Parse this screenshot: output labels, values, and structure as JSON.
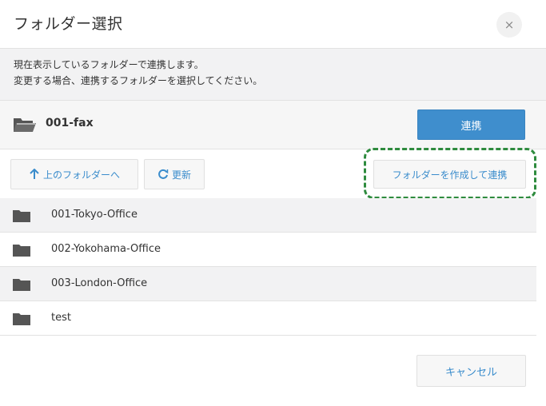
{
  "dialog": {
    "title": "フォルダー選択",
    "close_glyph": "×"
  },
  "info": {
    "line1": "現在表示しているフォルダーで連携します。",
    "line2": "変更する場合、連携するフォルダーを選択してください。"
  },
  "current_folder": {
    "name": "001-fax",
    "link_label": "連携"
  },
  "toolbar": {
    "up_label": "上のフォルダーへ",
    "refresh_label": "更新",
    "create_label": "フォルダーを作成して連携"
  },
  "folders": [
    {
      "name": "001-Tokyo-Office"
    },
    {
      "name": "002-Yokohama-Office"
    },
    {
      "name": "003-London-Office"
    },
    {
      "name": "test"
    }
  ],
  "footer": {
    "cancel_label": "キャンセル"
  },
  "colors": {
    "accent": "#3f8ecd",
    "link_text": "#3a8ccc",
    "highlight": "#2e8b3e",
    "folder_icon": "#555555"
  },
  "icons": {
    "open_folder": "folder-open-icon",
    "folder": "folder-icon",
    "arrow_up": "arrow-up-icon",
    "refresh": "refresh-icon",
    "close": "close-icon"
  }
}
